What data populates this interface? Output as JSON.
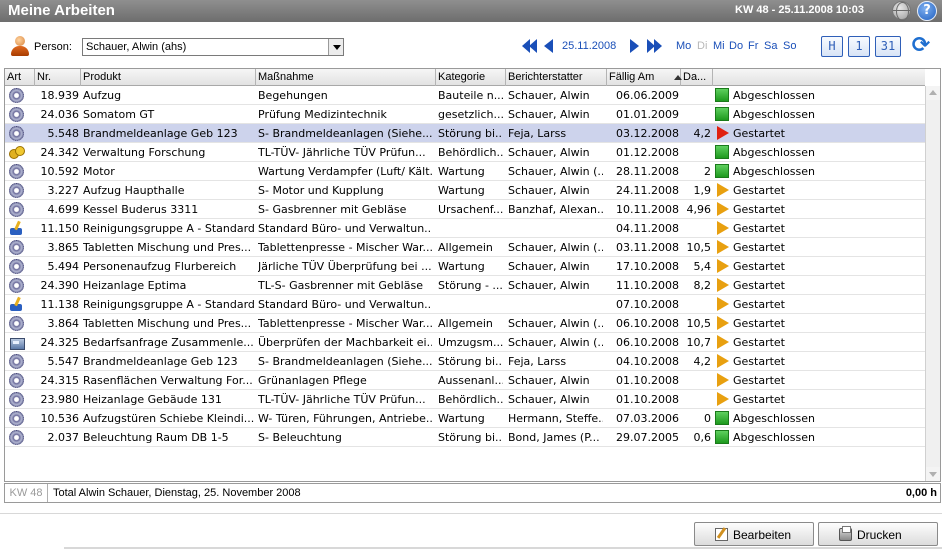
{
  "window": {
    "title": "Meine Arbeiten",
    "week_date": "KW 48 - 25.11.2008 10:03"
  },
  "toolbar": {
    "person_label": "Person:",
    "person_value": "Schauer, Alwin (ahs)",
    "nav_date": "25.11.2008",
    "weekdays": [
      {
        "label": "Mo",
        "enabled": true
      },
      {
        "label": "Di",
        "enabled": false
      },
      {
        "label": "Mi",
        "enabled": true
      },
      {
        "label": "Do",
        "enabled": true
      },
      {
        "label": "Fr",
        "enabled": true
      },
      {
        "label": "Sa",
        "enabled": true
      },
      {
        "label": "So",
        "enabled": true
      }
    ],
    "views": [
      "H",
      "1",
      "31"
    ]
  },
  "columns": [
    "Art",
    "Nr.",
    "Produkt",
    "Maßnahme",
    "Kategorie",
    "Berichterstatter",
    "Fällig Am",
    "Da..."
  ],
  "sorted_column": "Fällig Am",
  "rows": [
    {
      "icon": "gear",
      "nr": "18.939",
      "produkt": "Aufzug",
      "massnahme": "Begehungen",
      "kategorie": "Bauteile n...",
      "berichterstatter": "Schauer, Alwin",
      "faellig": "06.06.2009",
      "dauer": "",
      "status": "Abgeschlossen",
      "status_kind": "done",
      "selected": false
    },
    {
      "icon": "gear",
      "nr": "24.036",
      "produkt": "Somatom GT",
      "massnahme": "Prüfung Medizintechnik",
      "kategorie": "gesetzlich...",
      "berichterstatter": "Schauer, Alwin",
      "faellig": "01.01.2009",
      "dauer": "",
      "status": "Abgeschlossen",
      "status_kind": "done",
      "selected": false
    },
    {
      "icon": "gear",
      "nr": "5.548",
      "produkt": "Brandmeldeanlage Geb 123",
      "massnahme": "S- Brandmeldeanlagen (Siehe...",
      "kategorie": "Störung bi...",
      "berichterstatter": "Feja, Larss",
      "faellig": "03.12.2008",
      "dauer": "4,2",
      "status": "Gestartet",
      "status_kind": "started-red",
      "selected": true
    },
    {
      "icon": "keys",
      "nr": "24.342",
      "produkt": "Verwaltung Forschung",
      "massnahme": "TL-TÜV- Jährliche TÜV Prüfun...",
      "kategorie": "Behördlich...",
      "berichterstatter": "Schauer, Alwin",
      "faellig": "01.12.2008",
      "dauer": "",
      "status": "Abgeschlossen",
      "status_kind": "done",
      "selected": false
    },
    {
      "icon": "gear",
      "nr": "10.592",
      "produkt": "Motor",
      "massnahme": "Wartung Verdampfer (Luft/ Kält...",
      "kategorie": "Wartung",
      "berichterstatter": "Schauer, Alwin (...",
      "faellig": "28.11.2008",
      "dauer": "2",
      "status": "Abgeschlossen",
      "status_kind": "done",
      "selected": false
    },
    {
      "icon": "gear",
      "nr": "3.227",
      "produkt": "Aufzug Haupthalle",
      "massnahme": "S- Motor und Kupplung",
      "kategorie": "Wartung",
      "berichterstatter": "Schauer, Alwin",
      "faellig": "24.11.2008",
      "dauer": "1,9",
      "status": "Gestartet",
      "status_kind": "started",
      "selected": false
    },
    {
      "icon": "gear",
      "nr": "4.699",
      "produkt": "Kessel  Buderus 3311",
      "massnahme": "S- Gasbrenner mit Gebläse",
      "kategorie": "Ursachenf...",
      "berichterstatter": "Banzhaf, Alexan...",
      "faellig": "10.11.2008",
      "dauer": "4,96",
      "status": "Gestartet",
      "status_kind": "started",
      "selected": false
    },
    {
      "icon": "brush",
      "nr": "11.150",
      "produkt": "Reinigungsgruppe A - Standard",
      "massnahme": "Standard Büro- und Verwaltun...",
      "kategorie": "",
      "berichterstatter": "",
      "faellig": "04.11.2008",
      "dauer": "",
      "status": "Gestartet",
      "status_kind": "started",
      "selected": false
    },
    {
      "icon": "gear",
      "nr": "3.865",
      "produkt": "Tabletten Mischung und Pres...",
      "massnahme": "Tablettenpresse - Mischer War...",
      "kategorie": "Allgemein",
      "berichterstatter": "Schauer, Alwin (...",
      "faellig": "03.11.2008",
      "dauer": "10,5",
      "status": "Gestartet",
      "status_kind": "started",
      "selected": false
    },
    {
      "icon": "gear",
      "nr": "5.494",
      "produkt": "Personenaufzug Flurbereich",
      "massnahme": "Järliche TÜV Überprüfung bei ...",
      "kategorie": "Wartung",
      "berichterstatter": "Schauer, Alwin",
      "faellig": "17.10.2008",
      "dauer": "5,4",
      "status": "Gestartet",
      "status_kind": "started",
      "selected": false
    },
    {
      "icon": "gear",
      "nr": "24.390",
      "produkt": "Heizanlage Eptima",
      "massnahme": "TL-S- Gasbrenner mit Gebläse",
      "kategorie": "Störung - ...",
      "berichterstatter": "Schauer, Alwin",
      "faellig": "11.10.2008",
      "dauer": "8,2",
      "status": "Gestartet",
      "status_kind": "started",
      "selected": false
    },
    {
      "icon": "brush",
      "nr": "11.138",
      "produkt": "Reinigungsgruppe A - Standard",
      "massnahme": "Standard Büro- und Verwaltun...",
      "kategorie": "",
      "berichterstatter": "",
      "faellig": "07.10.2008",
      "dauer": "",
      "status": "Gestartet",
      "status_kind": "started",
      "selected": false
    },
    {
      "icon": "gear",
      "nr": "3.864",
      "produkt": "Tabletten Mischung und Pres...",
      "massnahme": "Tablettenpresse - Mischer War...",
      "kategorie": "Allgemein",
      "berichterstatter": "Schauer, Alwin (...",
      "faellig": "06.10.2008",
      "dauer": "10,5",
      "status": "Gestartet",
      "status_kind": "started",
      "selected": false
    },
    {
      "icon": "machine",
      "nr": "24.325",
      "produkt": "Bedarfsanfrage Zusammenle...",
      "massnahme": "Überprüfen der Machbarkeit ei...",
      "kategorie": "Umzugsm...",
      "berichterstatter": "Schauer, Alwin (...",
      "faellig": "06.10.2008",
      "dauer": "10,7",
      "status": "Gestartet",
      "status_kind": "started",
      "selected": false
    },
    {
      "icon": "gear",
      "nr": "5.547",
      "produkt": "Brandmeldeanlage Geb 123",
      "massnahme": "S- Brandmeldeanlagen (Siehe...",
      "kategorie": "Störung bi...",
      "berichterstatter": "Feja, Larss",
      "faellig": "04.10.2008",
      "dauer": "4,2",
      "status": "Gestartet",
      "status_kind": "started",
      "selected": false
    },
    {
      "icon": "gear",
      "nr": "24.315",
      "produkt": "Rasenflächen Verwaltung For...",
      "massnahme": "Grünanlagen Pflege",
      "kategorie": "Aussenanl...",
      "berichterstatter": "Schauer, Alwin",
      "faellig": "01.10.2008",
      "dauer": "",
      "status": "Gestartet",
      "status_kind": "started",
      "selected": false
    },
    {
      "icon": "gear",
      "nr": "23.980",
      "produkt": "Heizanlage Gebäude 131",
      "massnahme": "TL-TÜV- Jährliche TÜV Prüfun...",
      "kategorie": "Behördlich...",
      "berichterstatter": "Schauer, Alwin",
      "faellig": "01.10.2008",
      "dauer": "",
      "status": "Gestartet",
      "status_kind": "started",
      "selected": false
    },
    {
      "icon": "gear",
      "nr": "10.536",
      "produkt": "Aufzugstüren Schiebe Kleindi...",
      "massnahme": "W- Türen, Führungen, Antriebe...",
      "kategorie": "Wartung",
      "berichterstatter": "Hermann, Steffe...",
      "faellig": "07.03.2006",
      "dauer": "0",
      "status": "Abgeschlossen",
      "status_kind": "done",
      "selected": false
    },
    {
      "icon": "gear",
      "nr": "2.037",
      "produkt": "Beleuchtung Raum DB 1-5",
      "massnahme": "S- Beleuchtung",
      "kategorie": "Störung bi...",
      "berichterstatter": "Bond, James (P...",
      "faellig": "29.07.2005",
      "dauer": "0,6",
      "status": "Abgeschlossen",
      "status_kind": "done",
      "selected": false
    }
  ],
  "footer": {
    "kw": "KW 48",
    "total": "Total Alwin Schauer, Dienstag, 25. November 2008",
    "hours": "0,00 h"
  },
  "buttons": {
    "edit": "Bearbeiten",
    "print": "Drucken"
  },
  "colors": {
    "title_bar": "#7a7a7a",
    "accent": "#1a4fb8",
    "selected_row": "#cdd3ec",
    "done": "#2eaa2e",
    "started": "#e8a010",
    "started_overdue": "#e02010"
  }
}
